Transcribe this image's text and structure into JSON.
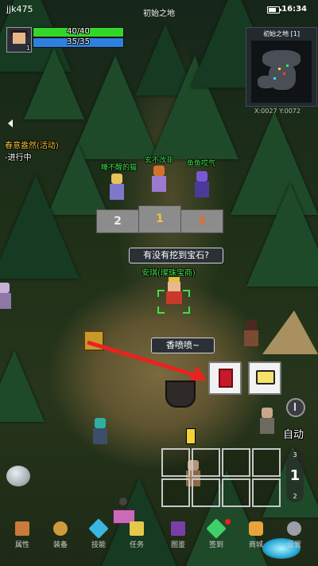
{
  "status": {
    "player_name": "jjk475",
    "map_title": "初始之地",
    "time": "16:34"
  },
  "player": {
    "level": "1",
    "hp_text": "40/40",
    "mp_text": "35/35",
    "hp_ratio": 1.0,
    "mp_ratio": 1.0
  },
  "minimap": {
    "title": "初始之地 [1]",
    "coords": "X:0027 Y:0072"
  },
  "quest": {
    "title": "春意盎然(活动)",
    "status": "-进行中"
  },
  "podium": {
    "names": [
      "睡不醒的猫",
      "玄不改非",
      "鱼鱼哎气"
    ],
    "ranks": [
      "2",
      "1",
      "3"
    ]
  },
  "hero": {
    "speech": "有没有挖到宝石?",
    "label": "安琪(璨珠宝商)"
  },
  "npc_speech": "香喷喷~",
  "controls": {
    "auto_label": "自动",
    "skill_page": "1",
    "page_up": "3",
    "page_down": "2"
  },
  "menu": [
    {
      "label": "属性",
      "icon": "character-icon"
    },
    {
      "label": "装备",
      "icon": "bag-icon"
    },
    {
      "label": "技能",
      "icon": "skill-icon"
    },
    {
      "label": "任务",
      "icon": "quest-icon"
    },
    {
      "label": "图鉴",
      "icon": "book-icon"
    },
    {
      "label": "签到",
      "icon": "gem-icon"
    },
    {
      "label": "商城",
      "icon": "shop-icon"
    },
    {
      "label": "设置",
      "icon": "gear-icon"
    }
  ],
  "colors": {
    "hp": "#35d62a",
    "mp": "#2e7fe0",
    "npc_name": "#3fe04b",
    "quest_title": "#f2c437",
    "arrow": "#e8231f"
  }
}
